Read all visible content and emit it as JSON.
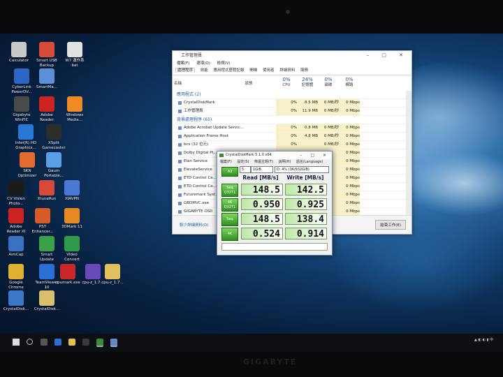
{
  "desktop": {
    "icons": [
      {
        "label": "Calculator",
        "color": "#c9c9c9"
      },
      {
        "label": "Smart USB\nBackup",
        "color": "#d84b3b"
      },
      {
        "label": "W7 運作系\nbat",
        "color": "#e2e2e2"
      },
      {
        "label": "CyberLink\nPowerDV...",
        "color": "#2f66c4"
      },
      {
        "label": "SmartMa...",
        "color": "#5c8fd6"
      },
      {
        "label": "Gigabyte\nWinFlC",
        "color": "#4a4a4a"
      },
      {
        "label": "Adobe\nReader",
        "color": "#cc2222"
      },
      {
        "label": "Windows\nMedia...",
        "color": "#f08a24"
      },
      {
        "label": "Intel(R) HD\nGraphics...",
        "color": "#2a78d6"
      },
      {
        "label": "XSplit\nGamecaster",
        "color": "#2d2d2d"
      },
      {
        "label": "SKN\nOptimizer",
        "color": "#e36b2f"
      },
      {
        "label": "Gaum\nPortable...",
        "color": "#5aa0e6"
      },
      {
        "label": "CV Vision\nPhoto...",
        "color": "#1b1b1b"
      },
      {
        "label": "XtuneRun",
        "color": "#d64a3a"
      },
      {
        "label": "XIAVPN",
        "color": "#4a7ad6"
      },
      {
        "label": "Adobe\nReader XI",
        "color": "#cc2222"
      },
      {
        "label": "PST\nEnhancer...",
        "color": "#d65a2a"
      },
      {
        "label": "3DMark 11",
        "color": "#e88a24"
      },
      {
        "label": "AimCap",
        "color": "#3b6fbf"
      },
      {
        "label": "Smart\nUpdate",
        "color": "#3ba04a"
      },
      {
        "label": "Video\nConvert",
        "color": "#2f9a4a"
      },
      {
        "label": "Google\nChrome",
        "color": "#e2b030"
      },
      {
        "label": "TeamViewer\n10",
        "color": "#2a6fd6"
      },
      {
        "label": "cpumark.exe",
        "color": "#c82828"
      },
      {
        "label": "cpu-z_1.7...",
        "color": "#6a4ab8"
      },
      {
        "label": "cpu-z_1.7...",
        "color": "#e2c060"
      },
      {
        "label": "CrystalDisk...",
        "color": "#3a78c8"
      },
      {
        "label": "CrystalDisk...",
        "color": "#d8c070"
      }
    ]
  },
  "task_manager": {
    "title": "工作管理員",
    "menu": [
      "檔案(F)",
      "選項(O)",
      "檢視(V)"
    ],
    "tabs": [
      "處理程序",
      "效能",
      "應用程式歷程記錄",
      "開機",
      "使用者",
      "詳細資料",
      "服務"
    ],
    "columns": [
      {
        "label": "名稱"
      },
      {
        "label": "狀態"
      },
      {
        "label": "CPU",
        "pct": "0%"
      },
      {
        "label": "記憶體",
        "pct": "24%"
      },
      {
        "label": "磁碟",
        "pct": "0%"
      },
      {
        "label": "網路",
        "pct": "0%"
      }
    ],
    "group_apps": "應用程式 (2)",
    "group_bg": "背景處理程序 (65)",
    "rows_apps": [
      {
        "name": "CrystalDiskMark",
        "cpu": "0%",
        "mem": "8.5 MB",
        "disk": "0 MB/秒",
        "net": "0 Mbps"
      },
      {
        "name": "工作管理員",
        "cpu": "0%",
        "mem": "11.9 MB",
        "disk": "0 MB/秒",
        "net": "0 Mbps"
      }
    ],
    "rows_bg": [
      {
        "name": "Adobe Acrobat Update Servic...",
        "cpu": "0%",
        "mem": "0.8 MB",
        "disk": "0 MB/秒",
        "net": "0 Mbps"
      },
      {
        "name": "Application Frame Host",
        "cpu": "0%",
        "mem": "4.8 MB",
        "disk": "0 MB/秒",
        "net": "0 Mbps"
      },
      {
        "name": "bcs (32 位元)",
        "cpu": "0%",
        "mem": "",
        "disk": "0 MB/秒",
        "net": "0 Mbps"
      },
      {
        "name": "Dolby Digital Pl...",
        "cpu": "",
        "mem": "",
        "disk": "",
        "net": "0 Mbps"
      },
      {
        "name": "Elan Service",
        "cpu": "",
        "mem": "",
        "disk": "",
        "net": "0 Mbps"
      },
      {
        "name": "ElevateService",
        "cpu": "",
        "mem": "",
        "disk": "",
        "net": "0 Mbps"
      },
      {
        "name": "ETD Control Ce...",
        "cpu": "",
        "mem": "",
        "disk": "",
        "net": "0 Mbps"
      },
      {
        "name": "ETD Control Ce...",
        "cpu": "",
        "mem": "",
        "disk": "",
        "net": "0 Mbps"
      },
      {
        "name": "Futuremark Syst...",
        "cpu": "",
        "mem": "",
        "disk": "",
        "net": "0 Mbps"
      },
      {
        "name": "GBDMVC.exe",
        "cpu": "",
        "mem": "",
        "disk": "",
        "net": "0 Mbps"
      },
      {
        "name": "GIGABYTE OSD",
        "cpu": "",
        "mem": "",
        "disk": "",
        "net": "0 Mbps"
      }
    ],
    "less_details": "較少詳細資料(D)",
    "end_task": "結束工作(E)"
  },
  "cdm": {
    "title": "CrystalDiskMark 5.1.0 x64",
    "menu": [
      "檔案(F)",
      "設定(S)",
      "佈還主題(T)",
      "說明(H)",
      "語言(Language)"
    ],
    "all_label": "All",
    "runs": "5",
    "size": "1GiB",
    "drive": "D: 4% (36/932GiB)",
    "read_header": "Read [MB/s]",
    "write_header": "Write [MB/s]",
    "tests": [
      {
        "label": "Seq\nQ32T1",
        "read": "148.5",
        "write": "142.5"
      },
      {
        "label": "4K\nQ32T1",
        "read": "0.950",
        "write": "0.925"
      },
      {
        "label": "Seq",
        "read": "148.5",
        "write": "138.4"
      },
      {
        "label": "4K",
        "read": "0.524",
        "write": "0.914"
      }
    ]
  },
  "laptop_brand": "GIGABYTE"
}
